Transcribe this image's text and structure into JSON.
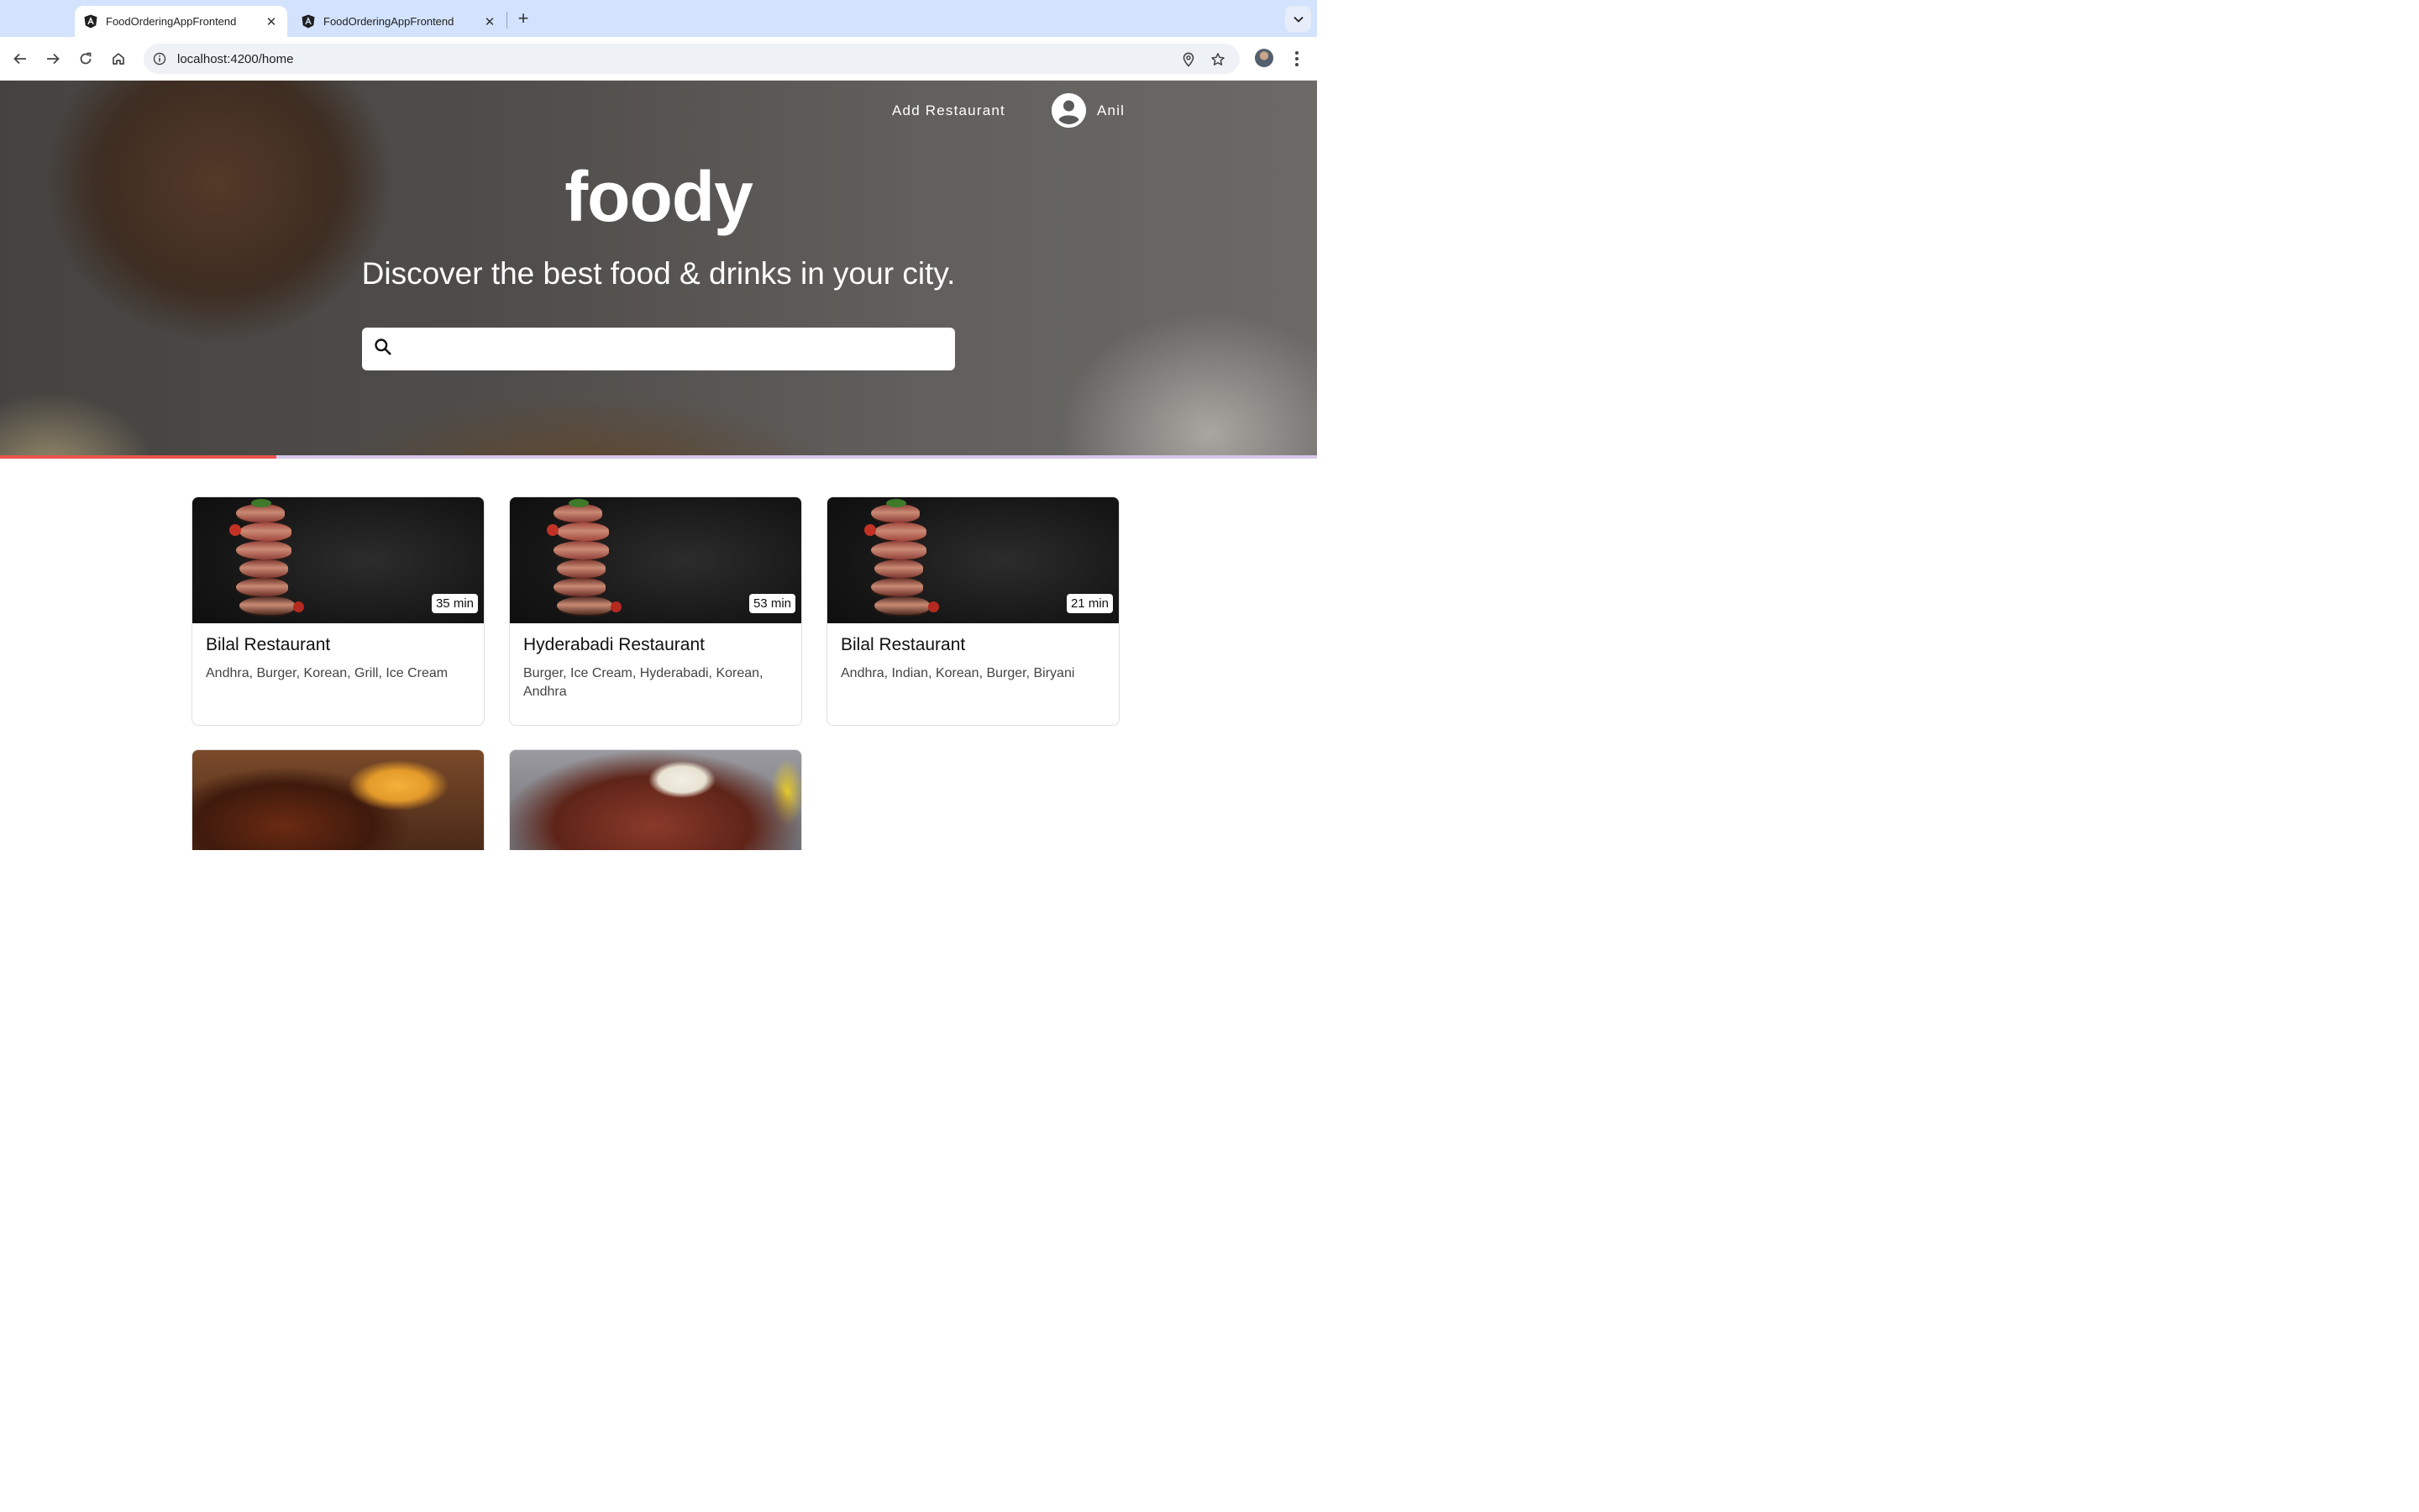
{
  "browser": {
    "tabs": [
      {
        "title": "FoodOrderingAppFrontend",
        "active": true
      },
      {
        "title": "FoodOrderingAppFrontend",
        "active": false
      }
    ],
    "close_glyph": "✕",
    "new_tab_glyph": "+",
    "url": "localhost:4200/home"
  },
  "header": {
    "add_restaurant": "Add Restaurant",
    "user_name": "Anil"
  },
  "hero": {
    "brand": "foody",
    "tagline": "Discover the best food & drinks in your city.",
    "search_placeholder": "",
    "search_value": ""
  },
  "progress": {
    "percent": 21,
    "fill_color": "#e8554e",
    "track_color": "#d7c6ea"
  },
  "restaurants": [
    {
      "name": "Bilal Restaurant",
      "cuisines": "Andhra, Burger, Korean, Grill, Ice Cream",
      "eta": "35 min",
      "image": "steak-slices-dark"
    },
    {
      "name": "Hyderabadi Restaurant",
      "cuisines": "Burger, Ice Cream, Hyderabadi, Korean, Andhra",
      "eta": "53 min",
      "image": "steak-slices-dark"
    },
    {
      "name": "Bilal Restaurant",
      "cuisines": "Andhra, Indian, Korean, Burger, Biryani",
      "eta": "21 min",
      "image": "steak-slices-dark"
    },
    {
      "image": "grilled-chicken-with-sauce"
    },
    {
      "image": "gulab-jamun-dessert"
    }
  ]
}
